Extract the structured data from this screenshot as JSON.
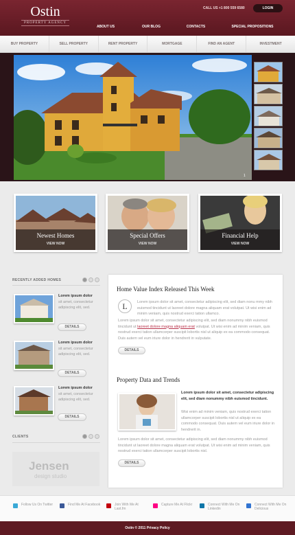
{
  "header": {
    "logo_main": "Ostin",
    "logo_sub": "PROPERTY AGENCY",
    "call": "CALL US +1 800 559 6580",
    "login": "LOGIN",
    "nav": [
      "ABOUT US",
      "OUR BLOG",
      "CONTACTS",
      "SPECIAL PROPOSITIONS"
    ]
  },
  "subnav": [
    "BUY PROPERTY",
    "SELL PROPERTY",
    "RENT PROPERTY",
    "MORTGAGE",
    "FIND AN AGENT",
    "INVESTMENT"
  ],
  "hero": {
    "pager": "1"
  },
  "features": [
    {
      "title": "Newest Homes",
      "cta": "VIEW NOW"
    },
    {
      "title": "Special Offers",
      "cta": "VIEW NOW"
    },
    {
      "title": "Financial Help",
      "cta": "VIEW NOW"
    }
  ],
  "sidebar": {
    "recent_title": "RECENTLY ADDED HOMES",
    "items": [
      {
        "bold": "Lorem ipsum dolor",
        "text": "sit amet, consectetur adipiscing elit, sed.",
        "button": "DETAILS"
      },
      {
        "bold": "Lorem ipsum dolor",
        "text": "sit amet, consectetur adipiscing elit, sed.",
        "button": "DETAILS"
      },
      {
        "bold": "Lorem ipsum dolor",
        "text": "sit amet, consectetur adipiscing elit, sed.",
        "button": "DETAILS"
      }
    ],
    "clients_title": "CLIENTS",
    "client_logo": {
      "name": "Jensen",
      "tag": "design studio"
    }
  },
  "main": {
    "sec1_title": "Home Value Index Released This Week",
    "dropcap": "L",
    "sec1_p1": "Lorem ipsum dolor sit amet, consectetur adipiscing elit, sed diam nonu mmy nibh euismod tincidunt ut laoreet dolore magna aliquam erat volutpat. Ut wisi enim ad minim veniam, quis nostrud exerci tation ullamco.",
    "sec1_p2a": "Lorem ipsum dolor sit amet, consectetur adipiscing elit, sed diam nonummy nibh euismod tincidunt ut ",
    "sec1_link": "laoreet dolore magna aliquam erat",
    "sec1_p2b": " volutpat. Ut wisi enim ad minim veniam, quis nostrud exerci tation ullamcorper suscipit lobortis nisl ut aliquip ex ea commodo consequat. Duis autem vel eum iriure dolor in hendrerit in vulputate.",
    "sec1_button": "DETAILS",
    "sec2_title": "Property Data and Trends",
    "sec2_bold": "Lorem ipsum dolor sit amet, consectetur adipiscing elit, sed diam nonummy nibh euismod tincidunt.",
    "sec2_p1": "Wisi enim ad minim veniam, quis nostrud exerci tation ullamcorper suscipit lobortis nisl ut aliquip ex ea commodo consequat. Duis autem vel eum iriure dolor in hendrerit in.",
    "sec2_p2": "Lorem ipsum dolor sit amet, consectetur adipiscing elit, sed diam nonummy nibh euismod tincidunt ut laoreet dolore magna aliquam erat volutpat. Ut wisi enim ad minim veniam, quis nostrud exerci tation ullamcorper suscipit lobortis nisl.",
    "sec2_button": "DETAILS"
  },
  "social": [
    {
      "label": "Follow Us On Twitter",
      "icon": "twitter-icon",
      "color": "#3aa9d6"
    },
    {
      "label": "Find Me At Facebook",
      "icon": "facebook-icon",
      "color": "#3b5998"
    },
    {
      "label": "Join With Me At Last.fm",
      "icon": "lastfm-icon",
      "color": "#c3000d"
    },
    {
      "label": "Capture Me At Flickr",
      "icon": "flickr-icon",
      "color": "#ff0084"
    },
    {
      "label": "Connect With Me On Linkedin",
      "icon": "linkedin-icon",
      "color": "#0e76a8"
    },
    {
      "label": "Connect With Me On Delicious",
      "icon": "delicious-icon",
      "color": "#3274d1"
    }
  ],
  "footer": "Ostin © 2011 Privacy Policy"
}
